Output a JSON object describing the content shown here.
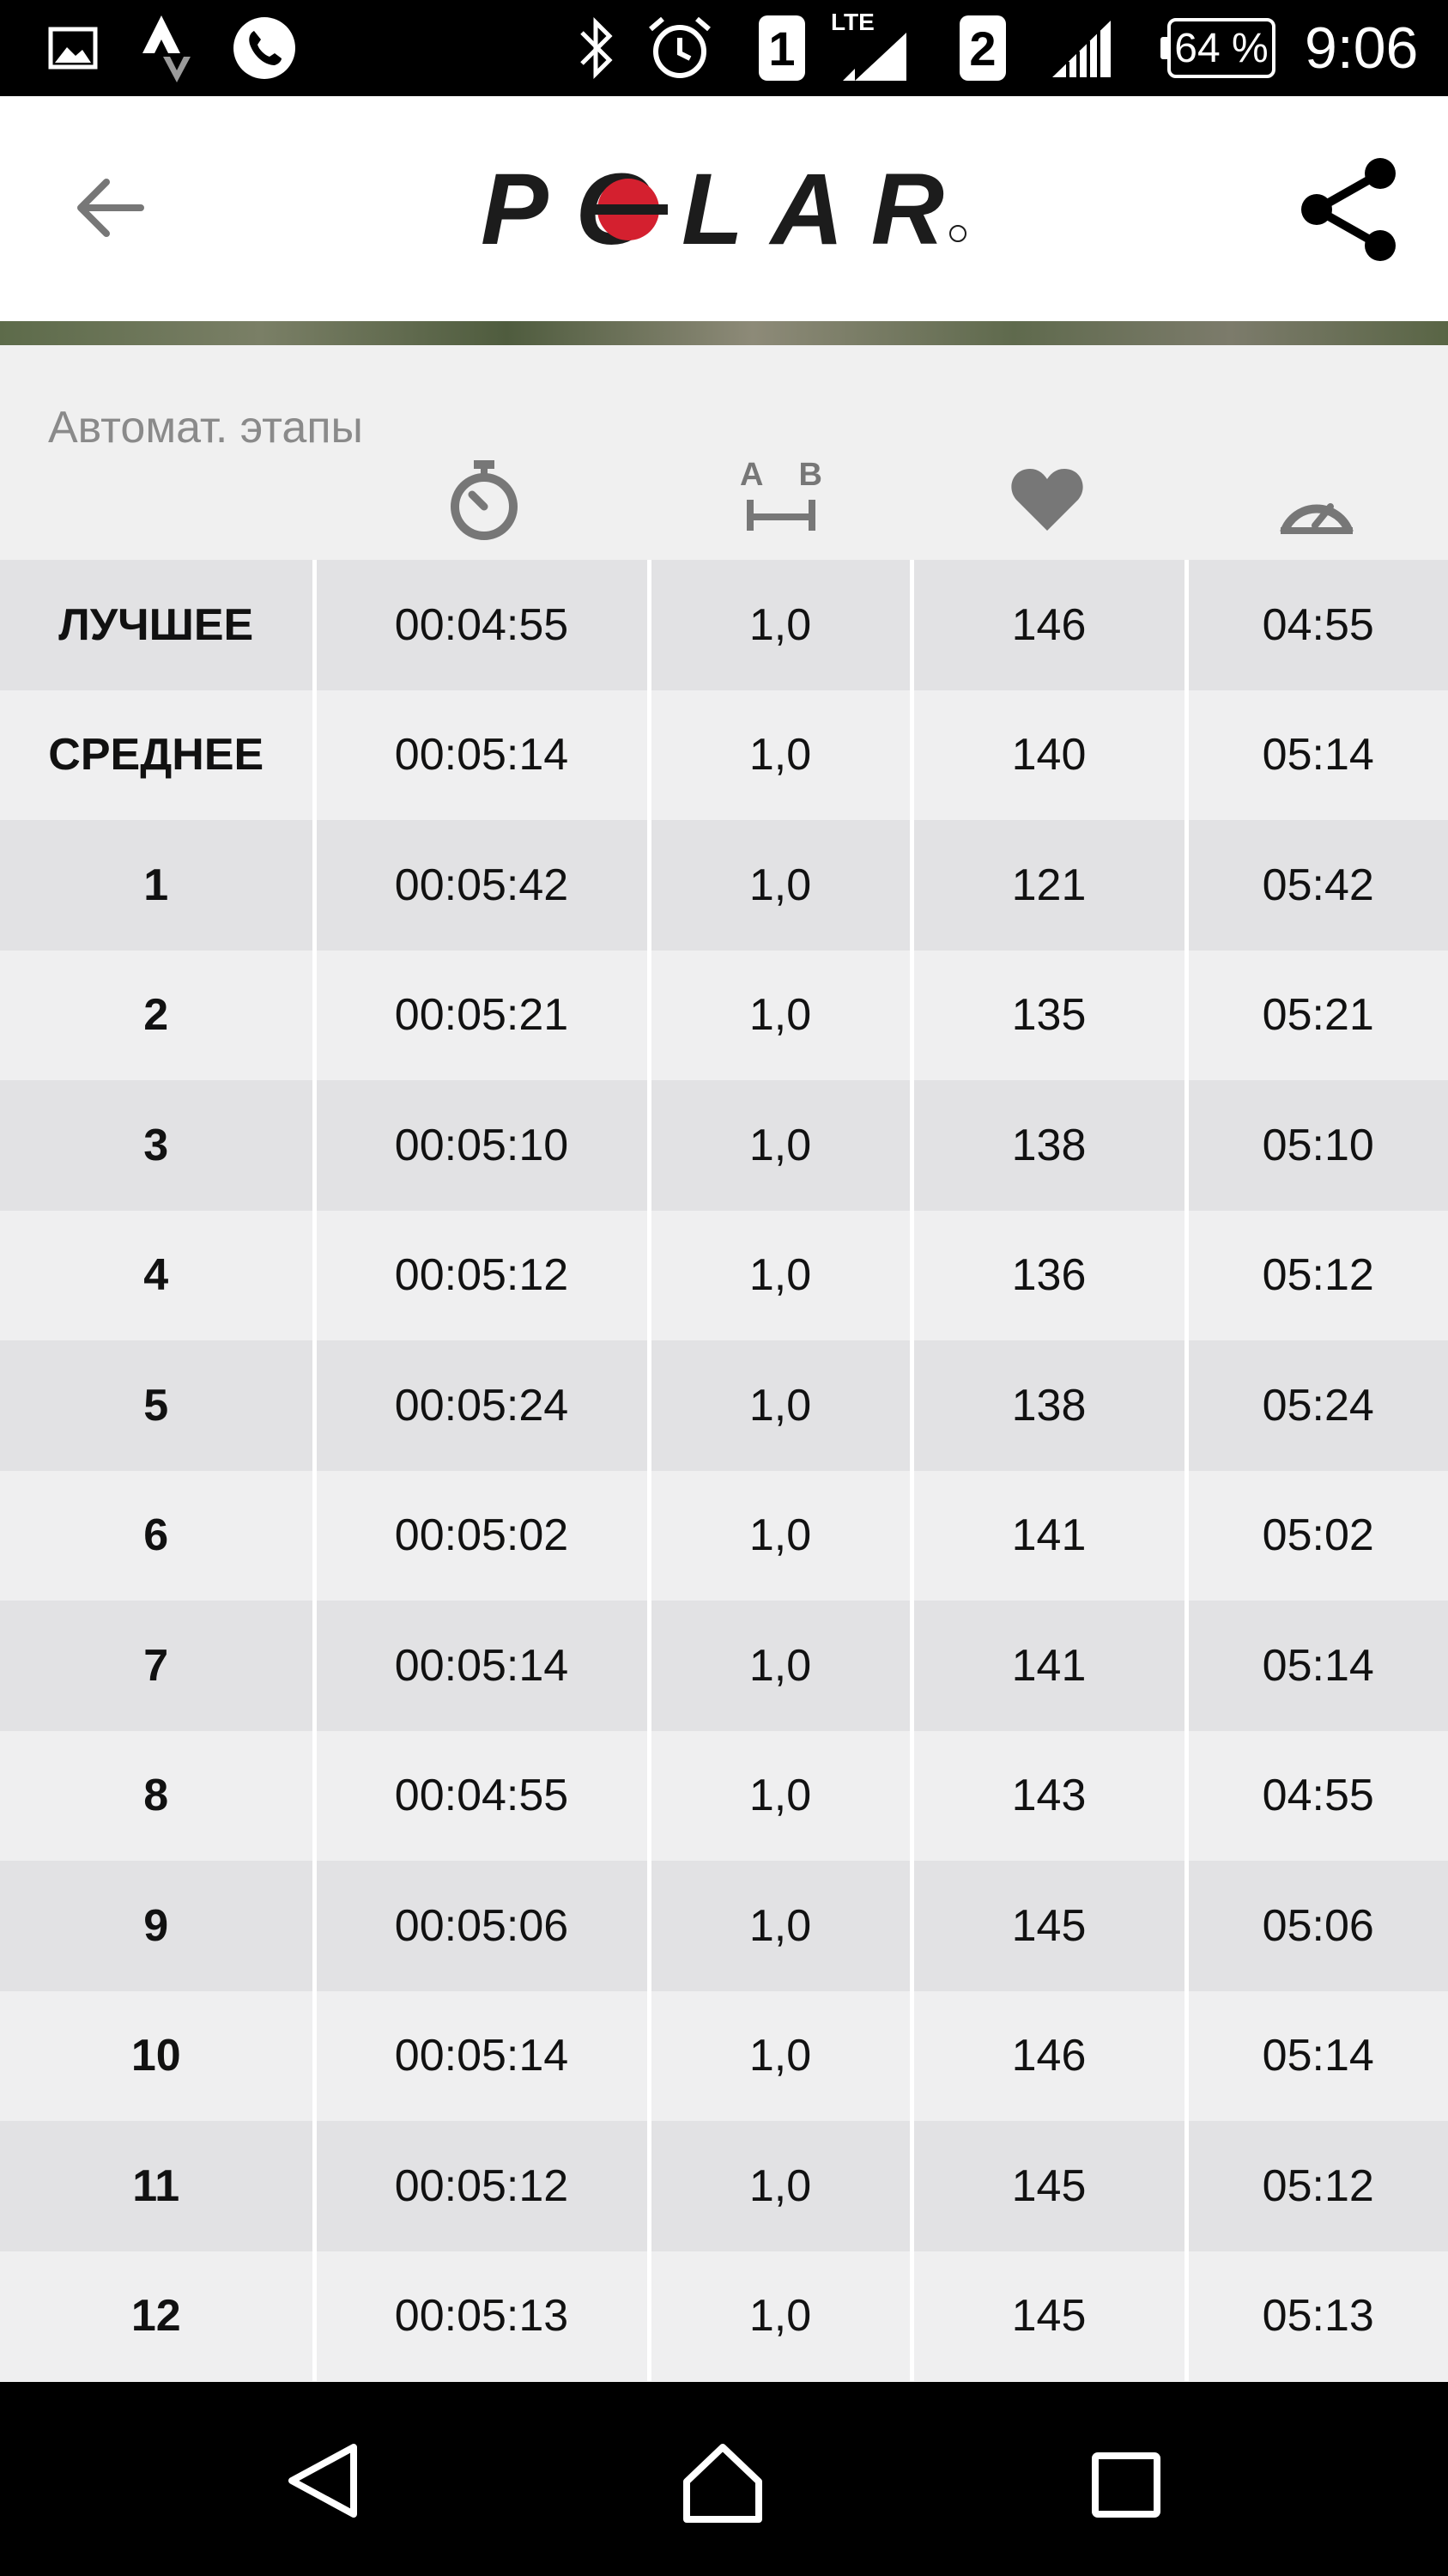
{
  "status_bar": {
    "sim1": "1",
    "sim2": "2",
    "network": "LTE",
    "battery": "64 %",
    "time": "9:06"
  },
  "app_bar": {
    "logo_text": "POLAR",
    "back_icon": "arrow-back-icon",
    "share_icon": "share-icon",
    "brand_color": "#d4202f"
  },
  "laps": {
    "title": "Автомат. этапы",
    "header_icons": [
      "stopwatch-icon",
      "distance-ab-icon",
      "heart-icon",
      "speedometer-icon"
    ],
    "distance_icon_letters": {
      "a": "A",
      "b": "B"
    },
    "rows": [
      {
        "label": "ЛУЧШЕЕ",
        "time": "00:04:55",
        "distance": "1,0",
        "hr": "146",
        "pace": "04:55"
      },
      {
        "label": "СРЕДНЕЕ",
        "time": "00:05:14",
        "distance": "1,0",
        "hr": "140",
        "pace": "05:14"
      },
      {
        "label": "1",
        "time": "00:05:42",
        "distance": "1,0",
        "hr": "121",
        "pace": "05:42"
      },
      {
        "label": "2",
        "time": "00:05:21",
        "distance": "1,0",
        "hr": "135",
        "pace": "05:21"
      },
      {
        "label": "3",
        "time": "00:05:10",
        "distance": "1,0",
        "hr": "138",
        "pace": "05:10"
      },
      {
        "label": "4",
        "time": "00:05:12",
        "distance": "1,0",
        "hr": "136",
        "pace": "05:12"
      },
      {
        "label": "5",
        "time": "00:05:24",
        "distance": "1,0",
        "hr": "138",
        "pace": "05:24"
      },
      {
        "label": "6",
        "time": "00:05:02",
        "distance": "1,0",
        "hr": "141",
        "pace": "05:02"
      },
      {
        "label": "7",
        "time": "00:05:14",
        "distance": "1,0",
        "hr": "141",
        "pace": "05:14"
      },
      {
        "label": "8",
        "time": "00:04:55",
        "distance": "1,0",
        "hr": "143",
        "pace": "04:55"
      },
      {
        "label": "9",
        "time": "00:05:06",
        "distance": "1,0",
        "hr": "145",
        "pace": "05:06"
      },
      {
        "label": "10",
        "time": "00:05:14",
        "distance": "1,0",
        "hr": "146",
        "pace": "05:14"
      },
      {
        "label": "11",
        "time": "00:05:12",
        "distance": "1,0",
        "hr": "145",
        "pace": "05:12"
      },
      {
        "label": "12",
        "time": "00:05:13",
        "distance": "1,0",
        "hr": "145",
        "pace": "05:13"
      }
    ]
  },
  "nav_bar": {
    "back": "nav-back-icon",
    "home": "nav-home-icon",
    "recents": "nav-recents-icon"
  }
}
